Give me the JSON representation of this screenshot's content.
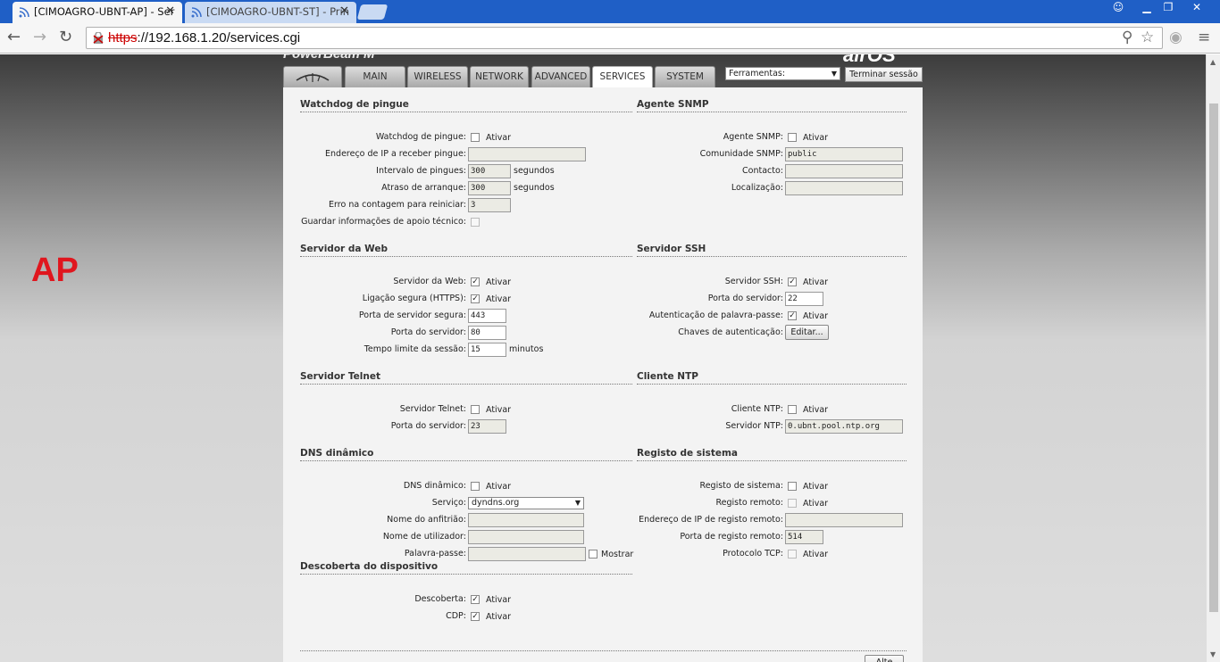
{
  "browser": {
    "tabs": [
      {
        "title": "[CIMOAGRO-UBNT-AP] - Ser",
        "active": true
      },
      {
        "title": "[CIMOAGRO-UBNT-ST] - Prin",
        "active": false
      }
    ],
    "url_scheme": "https",
    "url_rest": "://192.168.1.20/services.cgi"
  },
  "page": {
    "side_label": "AP",
    "product_name": "PowerBeam M",
    "product_suffix": "airOS",
    "nav_tabs": [
      "MAIN",
      "WIRELESS",
      "NETWORK",
      "ADVANCED",
      "SERVICES",
      "SYSTEM"
    ],
    "active_tab": "SERVICES",
    "tools_select": "Ferramentas:",
    "logout_label": "Terminar sessão"
  },
  "watchdog": {
    "title": "Watchdog de pingue",
    "enable_label": "Watchdog de pingue:",
    "enable_text": "Ativar",
    "enabled": false,
    "ip_label": "Endereço de IP a receber pingue:",
    "ip_value": "",
    "interval_label": "Intervalo de pingues:",
    "interval_value": "300",
    "interval_unit": "segundos",
    "delay_label": "Atraso de arranque:",
    "delay_value": "300",
    "delay_unit": "segundos",
    "fail_label": "Erro na contagem para reiniciar:",
    "fail_value": "3",
    "support_label": "Guardar informações de apoio técnico:"
  },
  "snmp": {
    "title": "Agente SNMP",
    "enable_label": "Agente SNMP:",
    "enable_text": "Ativar",
    "enabled": false,
    "community_label": "Comunidade SNMP:",
    "community_value": "public",
    "contact_label": "Contacto:",
    "contact_value": "",
    "location_label": "Localização:",
    "location_value": ""
  },
  "web": {
    "title": "Servidor da Web",
    "enable_label": "Servidor da Web:",
    "enable_text": "Ativar",
    "enabled": true,
    "https_label": "Ligação segura (HTTPS):",
    "https_text": "Ativar",
    "https_enabled": true,
    "secure_port_label": "Porta de servidor segura:",
    "secure_port_value": "443",
    "port_label": "Porta do servidor:",
    "port_value": "80",
    "timeout_label": "Tempo limite da sessão:",
    "timeout_value": "15",
    "timeout_unit": "minutos"
  },
  "ssh": {
    "title": "Servidor SSH",
    "enable_label": "Servidor SSH:",
    "enable_text": "Ativar",
    "enabled": true,
    "port_label": "Porta do servidor:",
    "port_value": "22",
    "password_auth_label": "Autenticação de palavra-passe:",
    "password_auth_text": "Ativar",
    "password_auth_enabled": true,
    "keys_label": "Chaves de autenticação:",
    "edit_button": "Editar..."
  },
  "telnet": {
    "title": "Servidor Telnet",
    "enable_label": "Servidor Telnet:",
    "enable_text": "Ativar",
    "enabled": false,
    "port_label": "Porta do servidor:",
    "port_value": "23"
  },
  "ntp": {
    "title": "Cliente NTP",
    "enable_label": "Cliente NTP:",
    "enable_text": "Ativar",
    "enabled": false,
    "server_label": "Servidor NTP:",
    "server_value": "0.ubnt.pool.ntp.org"
  },
  "ddns": {
    "title": "DNS dinâmico",
    "enable_label": "DNS dinâmico:",
    "enable_text": "Ativar",
    "enabled": false,
    "service_label": "Serviço:",
    "service_value": "dyndns.org",
    "host_label": "Nome do anfitrião:",
    "host_value": "",
    "user_label": "Nome de utilizador:",
    "user_value": "",
    "password_label": "Palavra-passe:",
    "password_value": "",
    "show_text": "Mostrar"
  },
  "syslog": {
    "title": "Registo de sistema",
    "enable_label": "Registo de sistema:",
    "enable_text": "Ativar",
    "enabled": false,
    "remote_label": "Registo remoto:",
    "remote_text": "Ativar",
    "remote_ip_label": "Endereço de IP de registo remoto:",
    "remote_ip_value": "",
    "remote_port_label": "Porta de registo remoto:",
    "remote_port_value": "514",
    "tcp_label": "Protocolo TCP:",
    "tcp_text": "Ativar"
  },
  "discovery": {
    "title": "Descoberta do dispositivo",
    "discovery_label": "Descoberta:",
    "discovery_text": "Ativar",
    "discovery_enabled": true,
    "cdp_label": "CDP:",
    "cdp_text": "Ativar",
    "cdp_enabled": true
  },
  "footer": {
    "apply_label": "Alte"
  }
}
